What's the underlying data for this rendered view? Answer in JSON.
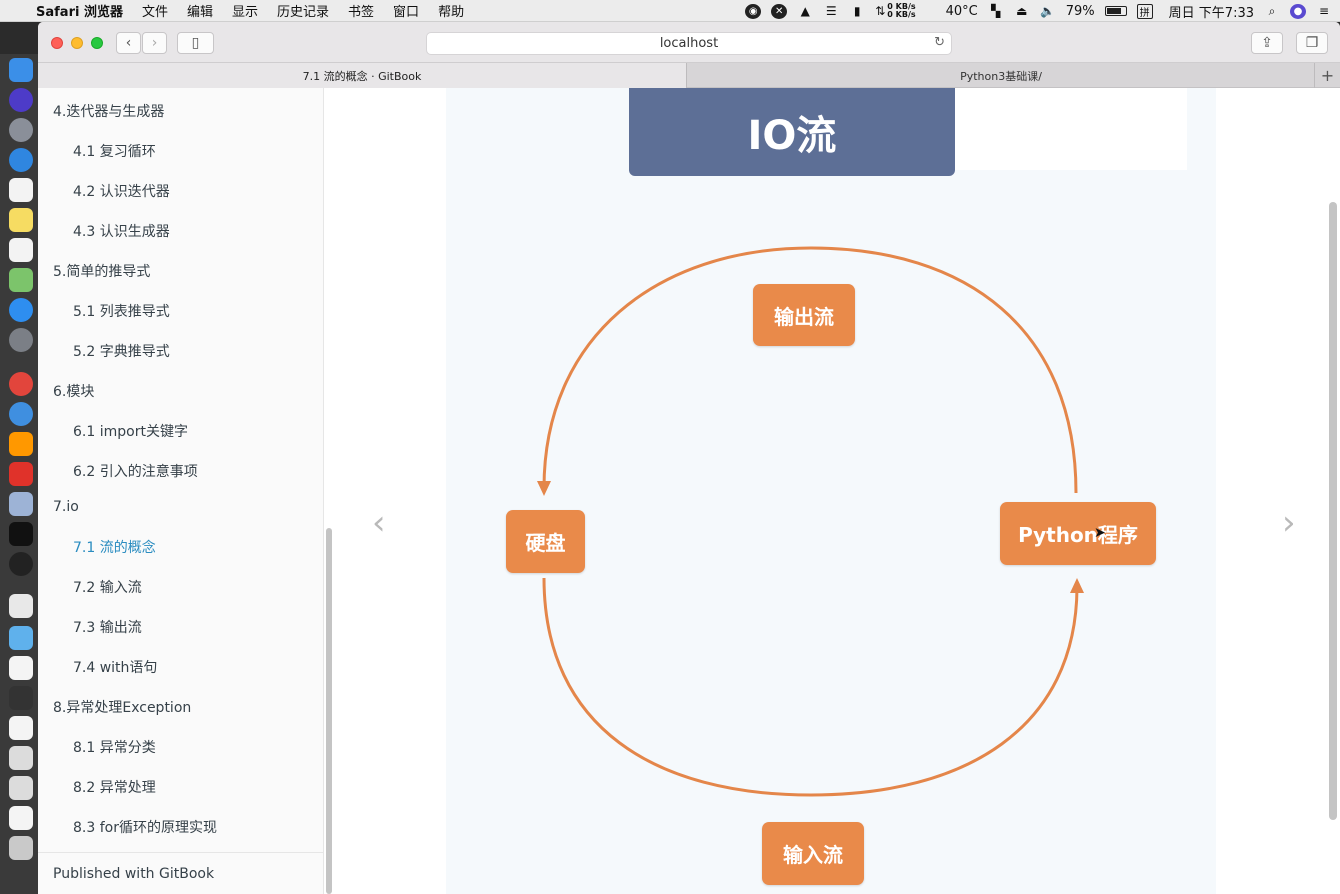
{
  "menubar": {
    "app_name": "Safari 浏览器",
    "menus": [
      "文件",
      "编辑",
      "显示",
      "历史记录",
      "书签",
      "窗口",
      "帮助"
    ],
    "net_up": "0 KB/s",
    "net_down": "0 KB/s",
    "temperature": "40°C",
    "battery_percent": "79%",
    "battery_level": 0.79,
    "input_method": "拼",
    "clock": "周日 下午7:33"
  },
  "browser": {
    "url": "localhost",
    "tabs": [
      {
        "label": "7.1 流的概念 · GitBook",
        "active": true
      },
      {
        "label": "Python3基础课/",
        "active": false
      }
    ]
  },
  "sidebar": {
    "items": [
      {
        "label": "4.迭代器与生成器",
        "level": 1
      },
      {
        "label": "4.1 复习循环",
        "level": 2
      },
      {
        "label": "4.2 认识迭代器",
        "level": 2
      },
      {
        "label": "4.3 认识生成器",
        "level": 2
      },
      {
        "label": "5.简单的推导式",
        "level": 1
      },
      {
        "label": "5.1 列表推导式",
        "level": 2
      },
      {
        "label": "5.2 字典推导式",
        "level": 2
      },
      {
        "label": "6.模块",
        "level": 1
      },
      {
        "label": "6.1 import关键字",
        "level": 2
      },
      {
        "label": "6.2 引入的注意事项",
        "level": 2
      },
      {
        "label": "7.io",
        "level": 1
      },
      {
        "label": "7.1 流的概念",
        "level": 2,
        "active": true
      },
      {
        "label": "7.2 输入流",
        "level": 2
      },
      {
        "label": "7.3 输出流",
        "level": 2
      },
      {
        "label": "7.4 with语句",
        "level": 2
      },
      {
        "label": "8.异常处理Exception",
        "level": 1
      },
      {
        "label": "8.1 异常分类",
        "level": 2
      },
      {
        "label": "8.2 异常处理",
        "level": 2
      },
      {
        "label": "8.3 for循环的原理实现",
        "level": 2
      }
    ],
    "footer": "Published with GitBook"
  },
  "slide": {
    "title": "IO流",
    "nodes": {
      "output": "输出流",
      "disk": "硬盘",
      "program": "Python程序",
      "input": "输入流"
    },
    "colors": {
      "title_bg": "#5d6f96",
      "node_bg": "#e98a4a",
      "arc": "#e4864a"
    }
  }
}
